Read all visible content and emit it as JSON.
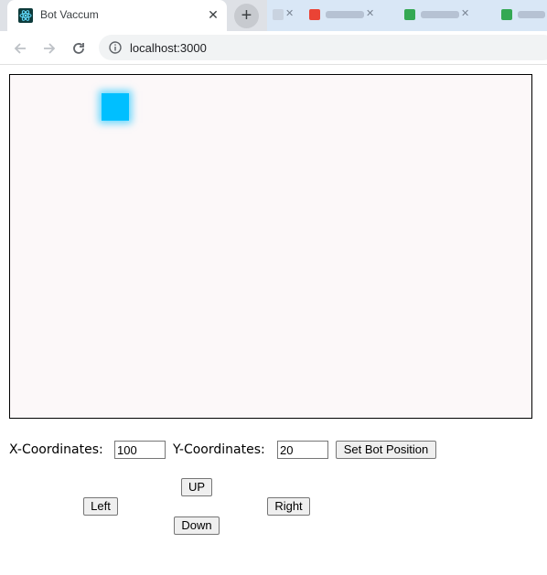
{
  "browser": {
    "tab_title": "Bot Vaccum",
    "close_glyph": "✕",
    "new_tab_glyph": "+",
    "url": "localhost:3000",
    "favicon": "react-icon"
  },
  "app": {
    "bot_color": "#00bfff",
    "room_background": "#fcf8f9",
    "x_label": "X-Coordinates:",
    "x_value": "100",
    "y_label": "Y-Coordinates:",
    "y_value": "20",
    "set_position_label": "Set Bot Position",
    "up_label": "UP",
    "left_label": "Left",
    "right_label": "Right",
    "down_label": "Down"
  }
}
